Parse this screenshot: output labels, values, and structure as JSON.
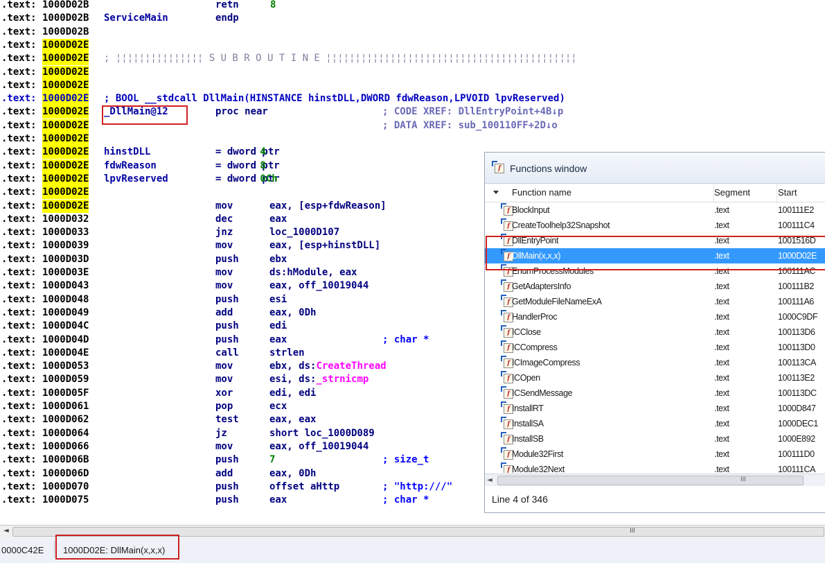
{
  "disasm": {
    "lines": [
      {
        "seg": ".text:",
        "addr": "1000D02B",
        "hl": false,
        "label": "",
        "mn": "retn",
        "op": "8",
        "op_class": "lit"
      },
      {
        "seg": ".text:",
        "addr": "1000D02B",
        "hl": false,
        "label": "ServiceMain",
        "mn": "endp",
        "op": ""
      },
      {
        "seg": ".text:",
        "addr": "1000D02B",
        "hl": false
      },
      {
        "seg": ".text:",
        "addr": "1000D02E",
        "hl": true
      },
      {
        "seg": ".text:",
        "addr": "1000D02E",
        "hl": true,
        "sub": "; ¦¦¦¦¦¦¦¦¦¦¦¦¦¦¦ S U B R O U T I N E ¦¦¦¦¦¦¦¦¦¦¦¦¦¦¦¦¦¦¦¦¦¦¦¦¦¦¦¦¦¦¦¦¦¦¦¦¦¦¦¦¦¦¦"
      },
      {
        "seg": ".text:",
        "addr": "1000D02E",
        "hl": true
      },
      {
        "seg": ".text:",
        "addr": "1000D02E",
        "hl": true
      },
      {
        "seg": ".text:",
        "addr": "1000D02E",
        "hl": true,
        "proto": "; BOOL __stdcall DllMain(HINSTANCE hinstDLL,DWORD fdwReason,LPVOID lpvReserved)",
        "seg_blue": true
      },
      {
        "seg": ".text:",
        "addr": "1000D02E",
        "hl": true,
        "label": "_DllMain@12",
        "mn": "proc near",
        "op": "",
        "cm": "; CODE XREF: DllEntryPoint+4B↓p"
      },
      {
        "seg": ".text:",
        "addr": "1000D02E",
        "hl": true,
        "cm": "; DATA XREF: sub_100110FF+2D↓o"
      },
      {
        "seg": ".text:",
        "addr": "1000D02E",
        "hl": true
      },
      {
        "seg": ".text:",
        "addr": "1000D02E",
        "hl": true,
        "label": "hinstDLL",
        "mn": "= dword ptr",
        "op": " 4"
      },
      {
        "seg": ".text:",
        "addr": "1000D02E",
        "hl": true,
        "label": "fdwReason",
        "mn": "= dword ptr",
        "op": " 8"
      },
      {
        "seg": ".text:",
        "addr": "1000D02E",
        "hl": true,
        "label": "lpvReserved",
        "mn": "= dword ptr",
        "op": " 0Ch"
      },
      {
        "seg": ".text:",
        "addr": "1000D02E",
        "hl": true
      },
      {
        "seg": ".text:",
        "addr": "1000D02E",
        "hl": true,
        "mn": "mov",
        "op": "eax, [esp+fdwReason]"
      },
      {
        "seg": ".text:",
        "addr": "1000D032",
        "mn": "dec",
        "op": "eax"
      },
      {
        "seg": ".text:",
        "addr": "1000D033",
        "mn": "jnz",
        "op": "loc_1000D107"
      },
      {
        "seg": ".text:",
        "addr": "1000D039",
        "mn": "mov",
        "op": "eax, [esp+hinstDLL]"
      },
      {
        "seg": ".text:",
        "addr": "1000D03D",
        "mn": "push",
        "op": "ebx"
      },
      {
        "seg": ".text:",
        "addr": "1000D03E",
        "mn": "mov",
        "op": "ds:hModule, eax"
      },
      {
        "seg": ".text:",
        "addr": "1000D043",
        "mn": "mov",
        "op": "eax, off_10019044"
      },
      {
        "seg": ".text:",
        "addr": "1000D048",
        "mn": "push",
        "op": "esi"
      },
      {
        "seg": ".text:",
        "addr": "1000D049",
        "mn": "add",
        "op": "eax, 0Dh"
      },
      {
        "seg": ".text:",
        "addr": "1000D04C",
        "mn": "push",
        "op": "edi"
      },
      {
        "seg": ".text:",
        "addr": "1000D04D",
        "mn": "push",
        "op": "eax",
        "cm": "; char *"
      },
      {
        "seg": ".text:",
        "addr": "1000D04E",
        "mn": "call",
        "op": "strlen"
      },
      {
        "seg": ".text:",
        "addr": "1000D053",
        "mn": "mov",
        "op": "ebx, ds:",
        "api": "CreateThread"
      },
      {
        "seg": ".text:",
        "addr": "1000D059",
        "mn": "mov",
        "op": "esi, ds:",
        "api": "_strnicmp"
      },
      {
        "seg": ".text:",
        "addr": "1000D05F",
        "mn": "xor",
        "op": "edi, edi"
      },
      {
        "seg": ".text:",
        "addr": "1000D061",
        "mn": "pop",
        "op": "ecx"
      },
      {
        "seg": ".text:",
        "addr": "1000D062",
        "mn": "test",
        "op": "eax, eax"
      },
      {
        "seg": ".text:",
        "addr": "1000D064",
        "mn": "jz",
        "op": "short loc_1000D089"
      },
      {
        "seg": ".text:",
        "addr": "1000D066",
        "mn": "mov",
        "op": "eax, off_10019044"
      },
      {
        "seg": ".text:",
        "addr": "1000D06B",
        "mn": "push",
        "op": "7",
        "cm": "; size_t"
      },
      {
        "seg": ".text:",
        "addr": "1000D06D",
        "mn": "add",
        "op": "eax, 0Dh"
      },
      {
        "seg": ".text:",
        "addr": "1000D070",
        "mn": "push",
        "op": "offset aHttp",
        "cm": "; \"http:///\""
      },
      {
        "seg": ".text:",
        "addr": "1000D075",
        "mn": "push",
        "op": "eax",
        "cm": "; char *"
      }
    ]
  },
  "functions_window": {
    "title": "Functions window",
    "columns": {
      "name": "Function name",
      "segment": "Segment",
      "start": "Start"
    },
    "rows": [
      {
        "name": "BlockInput",
        "segment": ".text",
        "start": "100111E2",
        "selected": false
      },
      {
        "name": "CreateToolhelp32Snapshot",
        "segment": ".text",
        "start": "100111C4",
        "selected": false
      },
      {
        "name": "DllEntryPoint",
        "segment": ".text",
        "start": "1001516D",
        "selected": false
      },
      {
        "name": "DllMain(x,x,x)",
        "segment": ".text",
        "start": "1000D02E",
        "selected": true
      },
      {
        "name": "EnumProcessModules",
        "segment": ".text",
        "start": "100111AC",
        "selected": false
      },
      {
        "name": "GetAdaptersInfo",
        "segment": ".text",
        "start": "100111B2",
        "selected": false
      },
      {
        "name": "GetModuleFileNameExA",
        "segment": ".text",
        "start": "100111A6",
        "selected": false
      },
      {
        "name": "HandlerProc",
        "segment": ".text",
        "start": "1000C9DF",
        "selected": false
      },
      {
        "name": "ICClose",
        "segment": ".text",
        "start": "100113D6",
        "selected": false
      },
      {
        "name": "ICCompress",
        "segment": ".text",
        "start": "100113D0",
        "selected": false
      },
      {
        "name": "ICImageCompress",
        "segment": ".text",
        "start": "100113CA",
        "selected": false
      },
      {
        "name": "ICOpen",
        "segment": ".text",
        "start": "100113E2",
        "selected": false
      },
      {
        "name": "ICSendMessage",
        "segment": ".text",
        "start": "100113DC",
        "selected": false
      },
      {
        "name": "InstallRT",
        "segment": ".text",
        "start": "1000D847",
        "selected": false
      },
      {
        "name": "InstallSA",
        "segment": ".text",
        "start": "1000DEC1",
        "selected": false
      },
      {
        "name": "InstallSB",
        "segment": ".text",
        "start": "1000E892",
        "selected": false
      },
      {
        "name": "Module32First",
        "segment": ".text",
        "start": "100111D0",
        "selected": false
      },
      {
        "name": "Module32Next",
        "segment": ".text",
        "start": "100111CA",
        "selected": false
      }
    ],
    "status": "Line 4 of 346",
    "scroll_grip": "III"
  },
  "status_bar": {
    "left": "0000C42E",
    "location": "1000D02E: DllMain(x,x,x)"
  },
  "hscroll_grip": "III",
  "icons": {
    "function": "function-icon",
    "left_arrow": "scroll-left-icon"
  }
}
